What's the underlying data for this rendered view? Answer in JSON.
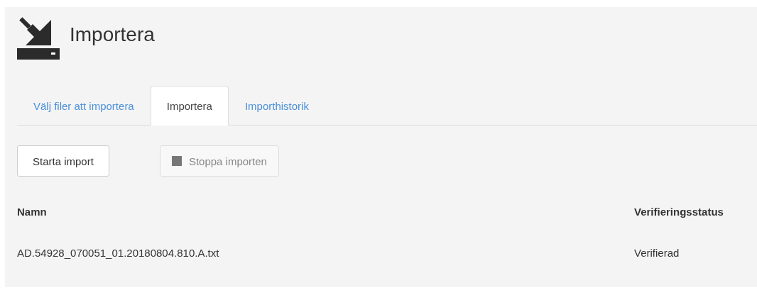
{
  "page": {
    "title": "Importera"
  },
  "tabs": [
    {
      "label": "Välj filer att importera",
      "selected": false
    },
    {
      "label": "Importera",
      "selected": true
    },
    {
      "label": "Importhistorik",
      "selected": false
    }
  ],
  "buttons": [
    {
      "label": "Starta import",
      "kind": "start",
      "disabled": false
    },
    {
      "label": "Stoppa importen",
      "kind": "stop",
      "disabled": true
    }
  ],
  "table": {
    "columns": [
      "Namn",
      "Verifieringsstatus"
    ],
    "rows": [
      [
        "AD.54928_070051_01.20180804.810.A.txt",
        "Verifierad"
      ]
    ]
  }
}
